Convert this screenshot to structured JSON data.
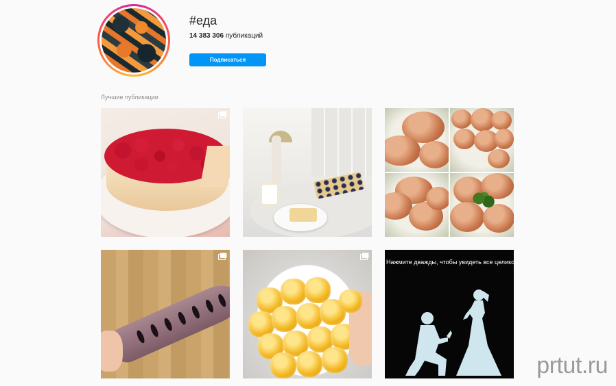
{
  "header": {
    "hashtag": "#еда",
    "post_count_number": "14 383 306",
    "post_count_suffix": " публикаций",
    "follow_label": "Подписаться"
  },
  "section": {
    "label": "Лучшие публикации"
  },
  "grid": {
    "posts": [
      {
        "description": "raspberry cheesecake",
        "multi": true,
        "icon": "multi-photo-icon"
      },
      {
        "description": "pastry with blueberries on table",
        "multi": false
      },
      {
        "description": "chicken cutlets collage",
        "multi": false
      },
      {
        "description": "stuffed fish on cutting board",
        "multi": true,
        "icon": "multi-photo-icon"
      },
      {
        "description": "yellow jelly candies on plate",
        "multi": true,
        "icon": "multi-photo-icon"
      },
      {
        "description": "silhouette proposal",
        "multi": false,
        "caption": "Нажмите дважды, чтобы увидеть все целиком"
      }
    ]
  },
  "watermark": "prtut.ru",
  "colors": {
    "follow_button": "#0095f6",
    "background": "#fafafa",
    "muted_text": "#8e8e8e"
  }
}
